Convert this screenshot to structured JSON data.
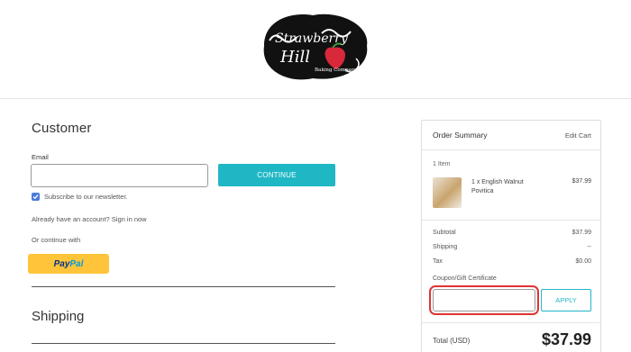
{
  "brand": {
    "logo_name": "Strawberry Hill Baking Company",
    "logo_lines": [
      "Strawberry",
      "Hill"
    ],
    "logo_sub": "Baking Company"
  },
  "customer": {
    "title": "Customer",
    "email_label": "Email",
    "email_value": "",
    "continue_label": "CONTINUE",
    "newsletter_label": "Subscribe to our newsletter.",
    "newsletter_checked": true,
    "signin_text": "Already have an account? Sign in now",
    "continue_with": "Or continue with",
    "paypal": {
      "part1": "Pay",
      "part2": "Pal"
    }
  },
  "shipping": {
    "title": "Shipping"
  },
  "summary": {
    "title": "Order Summary",
    "edit_cart": "Edit Cart",
    "item_count": "1 Item",
    "item": {
      "name": "1 x English Walnut Povitica",
      "price": "$37.99"
    },
    "rows": [
      {
        "label": "Subtotal",
        "value": "$37.99"
      },
      {
        "label": "Shipping",
        "value": "--"
      },
      {
        "label": "Tax",
        "value": "$0.00"
      }
    ],
    "coupon_label": "Coupon/Gift Certificate",
    "coupon_value": "",
    "apply_label": "APPLY",
    "total_label": "Total (USD)",
    "total_value": "$37.99"
  },
  "colors": {
    "accent": "#20b7c5",
    "paypal": "#ffc439",
    "highlight": "#e03434",
    "checkbox": "#4b7bd8"
  }
}
